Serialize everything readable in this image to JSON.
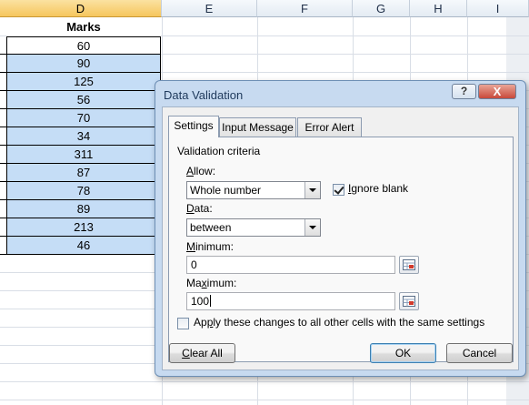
{
  "columns": {
    "d": "D",
    "e": "E",
    "f": "F",
    "g": "G",
    "h": "H",
    "i": "I"
  },
  "marks_header": "Marks",
  "marks": [
    "60",
    "90",
    "125",
    "56",
    "70",
    "34",
    "311",
    "87",
    "78",
    "89",
    "213",
    "46"
  ],
  "dialog": {
    "title": "Data Validation",
    "help_glyph": "?",
    "close_glyph": "X",
    "tabs": [
      "Settings",
      "Input Message",
      "Error Alert"
    ],
    "group_label": "Validation criteria",
    "allow": {
      "label_u": "A",
      "label_rest": "llow:",
      "value": "Whole number"
    },
    "ignore_blank": {
      "label_u": "I",
      "label_rest": "gnore blank",
      "checked": true
    },
    "data": {
      "label_u": "D",
      "label_rest": "ata:",
      "value": "between"
    },
    "minimum": {
      "label_u": "M",
      "label_rest": "inimum:",
      "value": "0"
    },
    "maximum": {
      "label_rest_pre": "Ma",
      "label_u": "x",
      "label_rest": "imum:",
      "value": "100"
    },
    "apply": {
      "label_pre": "Ap",
      "label_u": "p",
      "label_rest": "ly these changes to all other cells with the same settings",
      "checked": false
    },
    "buttons": {
      "clear_all": {
        "label_u": "C",
        "label_rest": "lear All"
      },
      "ok": "OK",
      "cancel": "Cancel"
    }
  },
  "colors": {
    "selection_fill": "#c5ddf6",
    "dialog_frame": "#c7daf0",
    "close_button": "#c8493a"
  }
}
